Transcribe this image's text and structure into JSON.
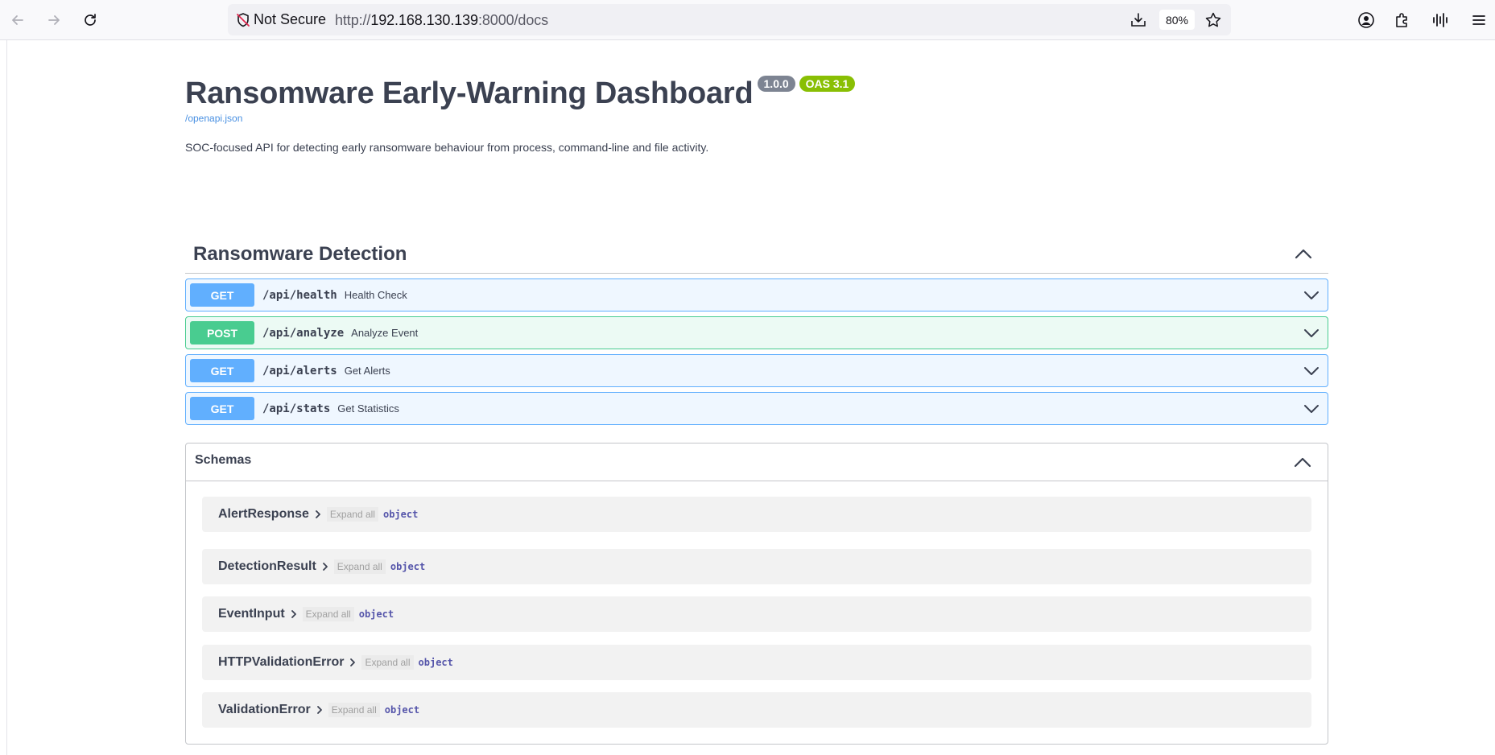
{
  "browser": {
    "security_label": "Not Secure",
    "url_prefix": "http://",
    "url_host": "192.168.130.139",
    "url_rest": ":8000/docs",
    "zoom": "80%",
    "icons": [
      "back-icon",
      "forward-icon",
      "reload-icon",
      "shield-slash-icon",
      "download-icon",
      "star-icon",
      "account-icon",
      "extensions-icon",
      "sidebar-icon",
      "menu-icon"
    ]
  },
  "api": {
    "title": "Ransomware Early-Warning Dashboard",
    "version": "1.0.0",
    "oas": "OAS 3.1",
    "spec_link": "/openapi.json",
    "description": "SOC-focused API for detecting early ransomware behaviour from process, command-line and file activity."
  },
  "tag": {
    "name": "Ransomware Detection",
    "operations": [
      {
        "method": "GET",
        "path": "/api/health",
        "summary": "Health Check"
      },
      {
        "method": "POST",
        "path": "/api/analyze",
        "summary": "Analyze Event"
      },
      {
        "method": "GET",
        "path": "/api/alerts",
        "summary": "Get Alerts"
      },
      {
        "method": "GET",
        "path": "/api/stats",
        "summary": "Get Statistics"
      }
    ]
  },
  "schemas": {
    "title": "Schemas",
    "expand_label": "Expand all",
    "items": [
      {
        "name": "AlertResponse",
        "type": "object"
      },
      {
        "name": "DetectionResult",
        "type": "object"
      },
      {
        "name": "EventInput",
        "type": "object"
      },
      {
        "name": "HTTPValidationError",
        "type": "object"
      },
      {
        "name": "ValidationError",
        "type": "object"
      }
    ]
  },
  "colors": {
    "get": "#61affe",
    "post": "#49cc90",
    "oas_badge": "#89bf04",
    "version_badge": "#7d8492",
    "text": "#3b4151"
  }
}
